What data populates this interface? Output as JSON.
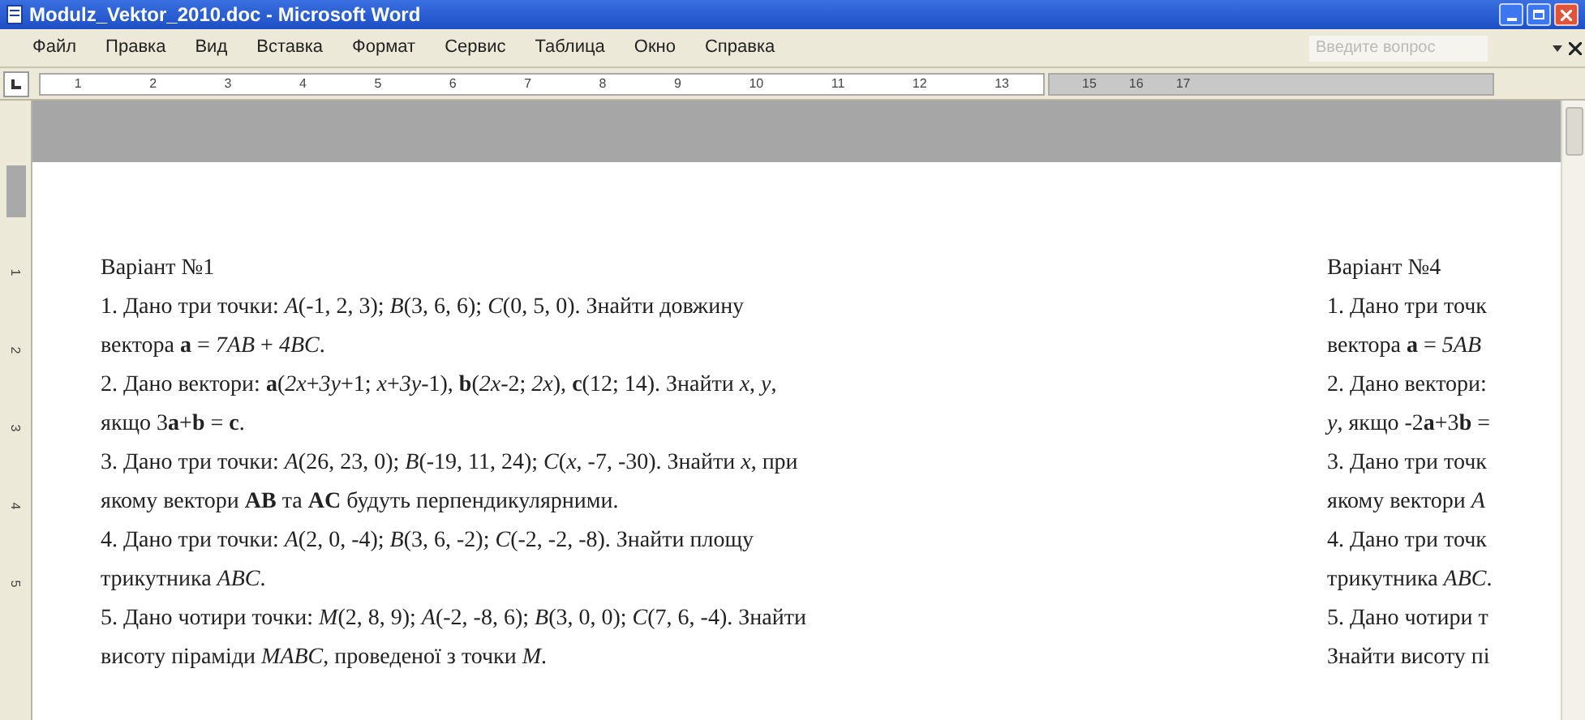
{
  "window": {
    "title": "Modulz_Vektor_2010.doc - Microsoft Word"
  },
  "menu": [
    "Файл",
    "Правка",
    "Вид",
    "Вставка",
    "Формат",
    "Сервис",
    "Таблица",
    "Окно",
    "Справка"
  ],
  "help_search": {
    "placeholder": "Введите вопрос"
  },
  "ruler": {
    "marks": [
      "1",
      "2",
      "3",
      "4",
      "5",
      "6",
      "7",
      "8",
      "9",
      "10",
      "11",
      "12",
      "13"
    ],
    "marks_after": [
      "15",
      "16",
      "17"
    ]
  },
  "vertical_ruler": {
    "marks": [
      "1",
      "2",
      "3",
      "4",
      "5"
    ]
  },
  "columns": [
    {
      "lines": [
        "Варіант №1",
        "1. Дано три точки: *A*(-1, 2, 3); *B*(3, 6, 6); *C*(0, 5, 0). Знайти довжину",
        "вектора **a** = *7AB* + *4BC*.",
        "2. Дано вектори: **a**(*2x*+*3y*+1; *x*+*3y*-1), **b**(*2x*-2; *2x*), **c**(12; 14). Знайти *x*, *y*,",
        "якщо 3**a**+**b** = **c**.",
        "3. Дано три точки: *A*(26, 23, 0); *B*(-19, 11, 24); *C*(*x*, -7, -30). Знайти *x*, при",
        "якому вектори **AB** та **AC** будуть перпендикулярними.",
        "4. Дано три точки: *A*(2, 0, -4); *B*(3, 6, -2); *C*(-2, -2, -8). Знайти площу",
        "трикутника *ABC*.",
        "5. Дано чотири точки: *M*(2, 8, 9); *A*(-2, -8, 6); *B*(3, 0, 0); *C*(7, 6, -4). Знайти",
        "висоту піраміди *MABC*, проведеної з точки *M*."
      ]
    },
    {
      "lines": [
        "Варіант №4",
        "1. Дано три точк",
        "вектора **a** = *5AB*",
        "2. Дано вектори:",
        "*y*, якщо -2**a**+3**b** =",
        "3. Дано три точк",
        "якому вектори *A*",
        "4. Дано три точк",
        "трикутника *ABC*.",
        "5. Дано чотири т",
        "Знайти висоту пі"
      ]
    }
  ]
}
